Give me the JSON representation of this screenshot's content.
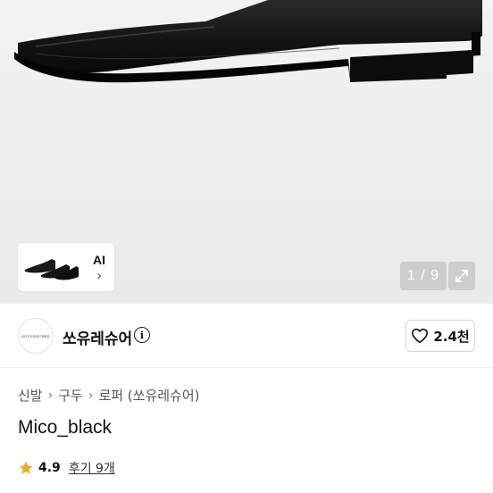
{
  "gallery": {
    "ai_label": "AI",
    "counter": "1 / 9"
  },
  "shop": {
    "avatar_text": "SOULESURES",
    "name": "쏘유레슈어",
    "likes": "2.4천"
  },
  "breadcrumb": [
    "신발",
    "구두",
    "로퍼 (쏘유레슈어)"
  ],
  "product": {
    "title": "Mico_black",
    "rating": "4.9",
    "reviews": "후기 9개"
  },
  "colors": {
    "star": "#f5a623",
    "accent": "#111111"
  }
}
